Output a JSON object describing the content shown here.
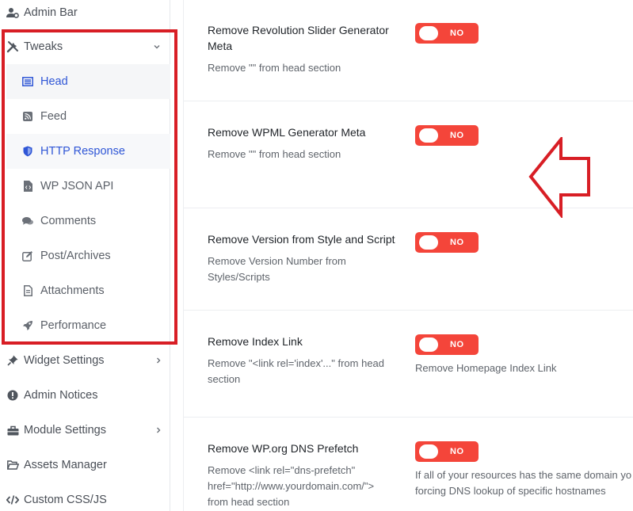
{
  "sidebar": {
    "admin_bar": "Admin Bar",
    "tweaks": "Tweaks",
    "sub_items": {
      "head": "Head",
      "feed": "Feed",
      "http_response": "HTTP Response",
      "wp_json_api": "WP JSON API",
      "comments": "Comments",
      "post_archives": "Post/Archives",
      "attachments": "Attachments",
      "performance": "Performance"
    },
    "widget_settings": "Widget Settings",
    "admin_notices": "Admin Notices",
    "module_settings": "Module Settings",
    "assets_manager": "Assets Manager",
    "custom_css_js": "Custom CSS/JS"
  },
  "settings": [
    {
      "title": "Remove Revolution Slider Generator Meta",
      "desc": "Remove \"\" from head section",
      "toggle": "NO",
      "note": ""
    },
    {
      "title": "Remove WPML Generator Meta",
      "desc": "Remove \"\" from head section",
      "toggle": "NO",
      "note": ""
    },
    {
      "title": "Remove Version from Style and Script",
      "desc": "Remove Version Number from Styles/Scripts",
      "toggle": "NO",
      "note": ""
    },
    {
      "title": "Remove Index Link",
      "desc": "Remove \"<link rel='index'...\" from head section",
      "toggle": "NO",
      "note": "Remove Homepage Index Link"
    },
    {
      "title": "Remove WP.org DNS Prefetch",
      "desc": "Remove <link rel=\"dns-prefetch\" href=\"http://www.yourdomain.com/\"> from head section",
      "toggle": "NO",
      "note": "If all of your resources has the same domain yo",
      "note2": "forcing DNS lookup of specific hostnames"
    }
  ],
  "colors": {
    "toggle_off": "#f4453a",
    "active_link": "#2f56d6",
    "highlight_box": "#d81e25",
    "arrow": "#d81e25"
  }
}
